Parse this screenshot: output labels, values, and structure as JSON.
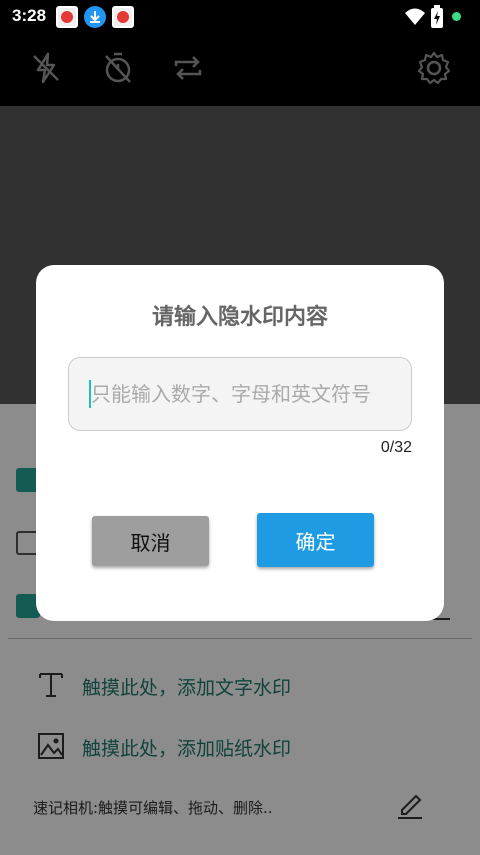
{
  "status_bar": {
    "time": "3:28",
    "notification_icons": [
      "app-notification-icon",
      "download-icon",
      "app-notification-icon"
    ],
    "system_icons": [
      "wifi-icon",
      "battery-charging-icon",
      "green-dot-icon"
    ]
  },
  "camera_toolbar": {
    "icons": [
      "flash-off-icon",
      "timer-off-icon",
      "switch-camera-icon",
      "settings-gear-icon"
    ]
  },
  "panel": {
    "rows": [
      {
        "label": "触摸此处，添加文字水印",
        "icon": "text-icon"
      },
      {
        "label": "触摸此处，添加贴纸水印",
        "icon": "image-icon"
      }
    ],
    "footer_text": "速记相机:触摸可编辑、拖动、删除..",
    "footer_icon": "edit-pencil-icon",
    "checkboxes": [
      true,
      false,
      true
    ]
  },
  "dialog": {
    "title": "请输入隐水印内容",
    "input_value": "",
    "input_placeholder": "只能输入数字、字母和英文符号",
    "counter": "0/32",
    "cancel_label": "取消",
    "confirm_label": "确定"
  },
  "colors": {
    "accent_teal": "#26a69a",
    "confirm_blue": "#1e9be3",
    "cancel_gray": "#9e9e9e",
    "row_text_green": "#1f7a6d"
  }
}
